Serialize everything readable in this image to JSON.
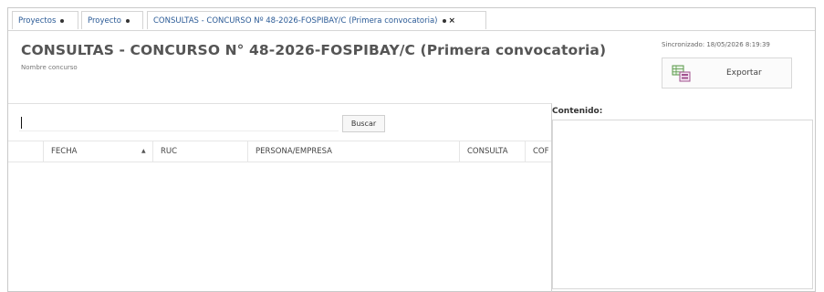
{
  "tabs": [
    {
      "label": "Proyectos"
    },
    {
      "label": "Proyecto"
    },
    {
      "label": "CONSULTAS  - CONCURSO Nº 48-2026-FOSPIBAY/C (Primera convocatoria)",
      "close": "×"
    }
  ],
  "header": {
    "title": "CONSULTAS  - CONCURSO N° 48-2026-FOSPIBAY/C (Primera convocatoria)",
    "subtitle": "Nombre concurso",
    "sync_text": "Sincronizado: 18/05/2026 8:19:39",
    "export_label": "Exportar"
  },
  "search": {
    "value": "",
    "placeholder": "",
    "button_label": "Buscar"
  },
  "grid": {
    "columns": [
      "FECHA",
      "RUC",
      "PERSONA/EMPRESA",
      "CONSULTA",
      "COF"
    ],
    "sort_indicator": "▲",
    "rows": []
  },
  "content_panel": {
    "label": "Contenido:"
  },
  "colors": {
    "tab_text": "#2a5a96",
    "title": "#555555",
    "border": "#d0d0d0"
  }
}
